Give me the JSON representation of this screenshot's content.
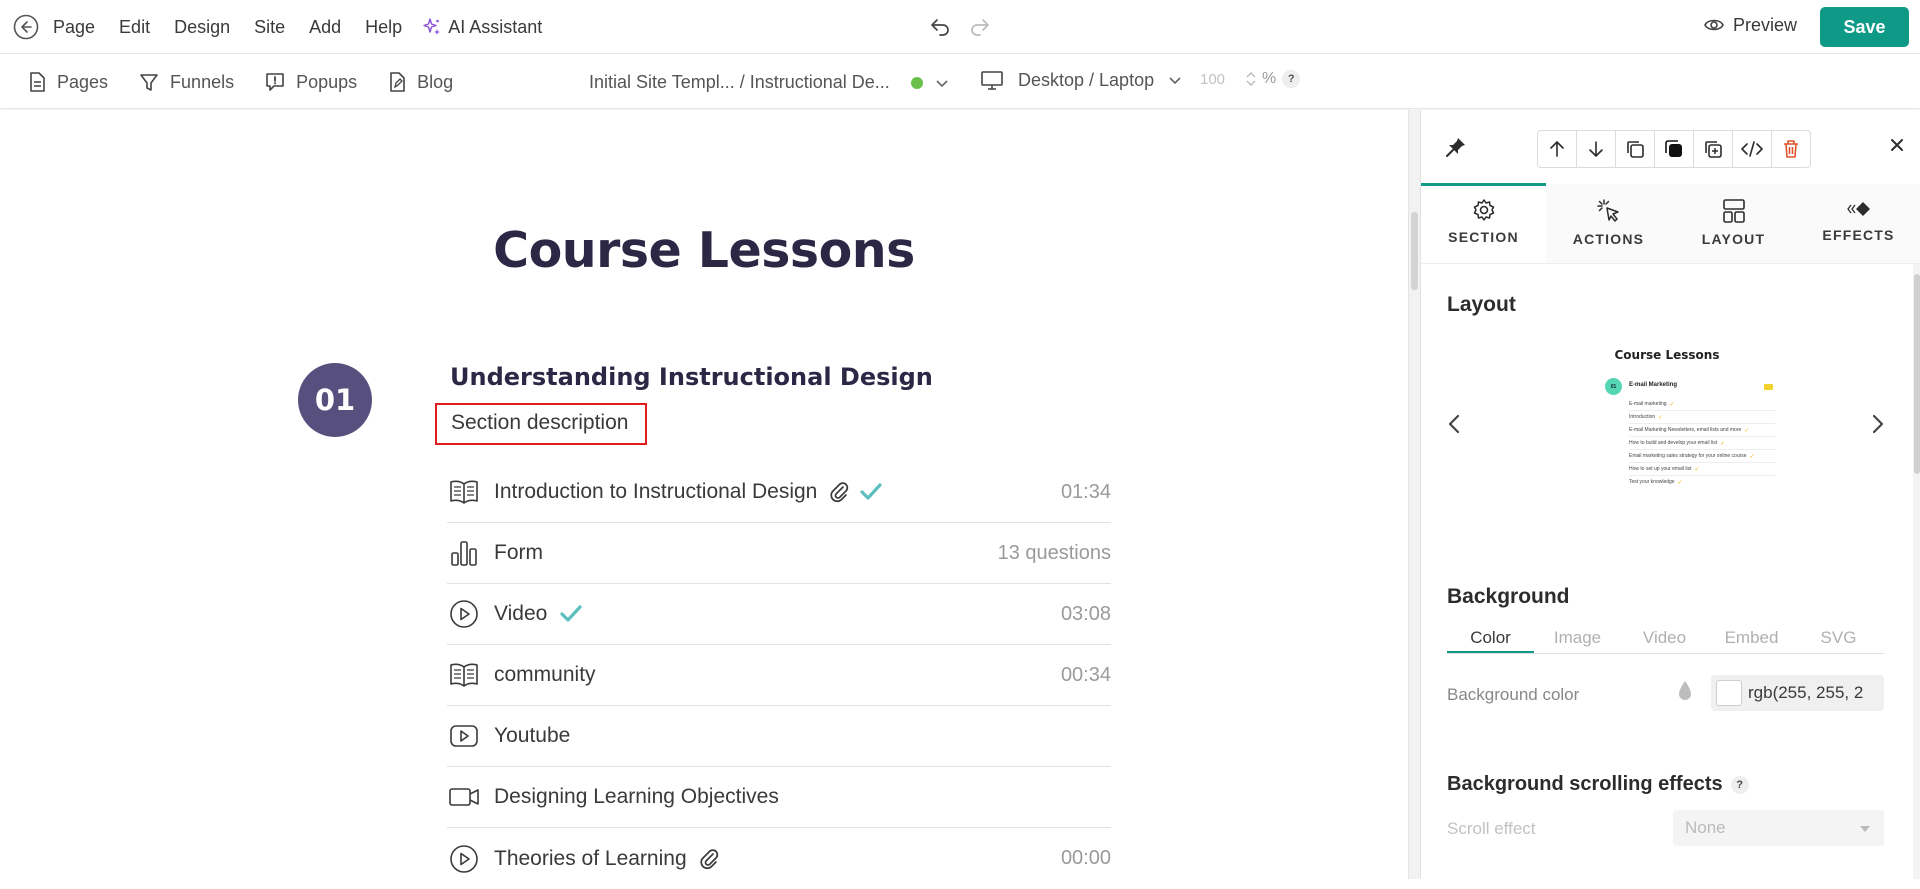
{
  "topbar": {
    "menu": [
      "Page",
      "Edit",
      "Design",
      "Site",
      "Add",
      "Help"
    ],
    "ai_label": "AI Assistant",
    "preview_label": "Preview",
    "save_label": "Save",
    "accent_color": "#0e9a86"
  },
  "subbar": {
    "nav": [
      "Pages",
      "Funnels",
      "Popups",
      "Blog"
    ],
    "breadcrumb": "Initial Site Templ... / Instructional De...",
    "status_color": "#6bc04b",
    "device": "Desktop / Laptop",
    "zoom_value": "100",
    "zoom_unit": "%",
    "help": "?"
  },
  "canvas": {
    "title": "Course Lessons",
    "section_number": "01",
    "section_title": "Understanding Instructional Design",
    "section_description": "Section description",
    "lessons": [
      {
        "icon": "book-icon",
        "title": "Introduction to Instructional Design",
        "attachment": true,
        "check": true,
        "meta": "01:34"
      },
      {
        "icon": "bar-chart-icon",
        "title": "Form",
        "attachment": false,
        "check": false,
        "meta": "13 questions"
      },
      {
        "icon": "play-circle-icon",
        "title": "Video",
        "attachment": false,
        "check": true,
        "meta": "03:08"
      },
      {
        "icon": "book-icon",
        "title": "community",
        "attachment": false,
        "check": false,
        "meta": "00:34"
      },
      {
        "icon": "play-square-icon",
        "title": "Youtube",
        "attachment": false,
        "check": false,
        "meta": ""
      },
      {
        "icon": "video-camera-icon",
        "title": "Designing Learning Objectives",
        "attachment": false,
        "check": false,
        "meta": ""
      },
      {
        "icon": "play-circle-icon",
        "title": "Theories of Learning",
        "attachment": true,
        "check": false,
        "meta": "00:00"
      }
    ]
  },
  "panel": {
    "tabs": [
      "SECTION",
      "ACTIONS",
      "LAYOUT",
      "EFFECTS"
    ],
    "active_tab": "SECTION",
    "layout_heading": "Layout",
    "thumbnail": {
      "title": "Course Lessons",
      "badge": "01",
      "section": "E-mail Marketing",
      "rows": [
        "E-mail marketing",
        "Introduction",
        "E-mail Marketing Newsletters, email lists and more",
        "How to build and develop your email list",
        "Email marketing sales strategy for your online course",
        "How to set up your email list",
        "Test your knowledge"
      ]
    },
    "background_heading": "Background",
    "bg_tabs": [
      "Color",
      "Image",
      "Video",
      "Embed",
      "SVG"
    ],
    "bg_active": "Color",
    "bg_color_label": "Background color",
    "bg_color_value": "rgb(255, 255, 2",
    "scroll_heading": "Background scrolling effects",
    "scroll_help": "?",
    "scroll_label": "Scroll effect",
    "scroll_value": "None"
  }
}
